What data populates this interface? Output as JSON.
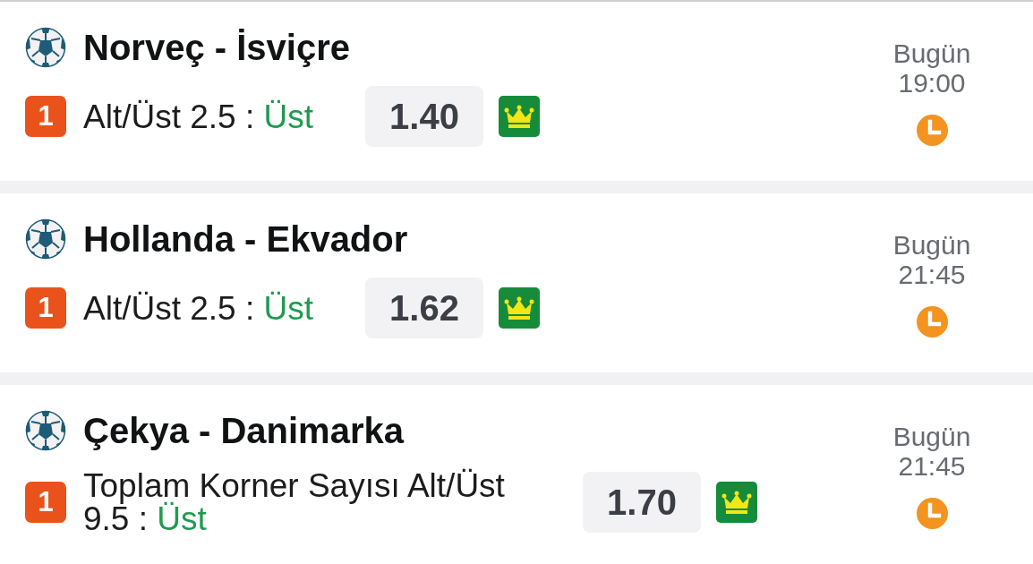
{
  "matches": [
    {
      "title": "Norveç - İsviçre",
      "badge": "1",
      "market": "Alt/Üst 2.5 :",
      "pick": "Üst",
      "odds": "1.40",
      "day": "Bugün",
      "time": "19:00"
    },
    {
      "title": "Hollanda - Ekvador",
      "badge": "1",
      "market": "Alt/Üst 2.5 :",
      "pick": "Üst",
      "odds": "1.62",
      "day": "Bugün",
      "time": "21:45"
    },
    {
      "title": "Çekya - Danimarka",
      "badge": "1",
      "market": "Toplam Korner Sayısı Alt/Üst 9.5 :",
      "pick": "Üst",
      "odds": "1.70",
      "day": "Bugün",
      "time": "21:45"
    }
  ]
}
